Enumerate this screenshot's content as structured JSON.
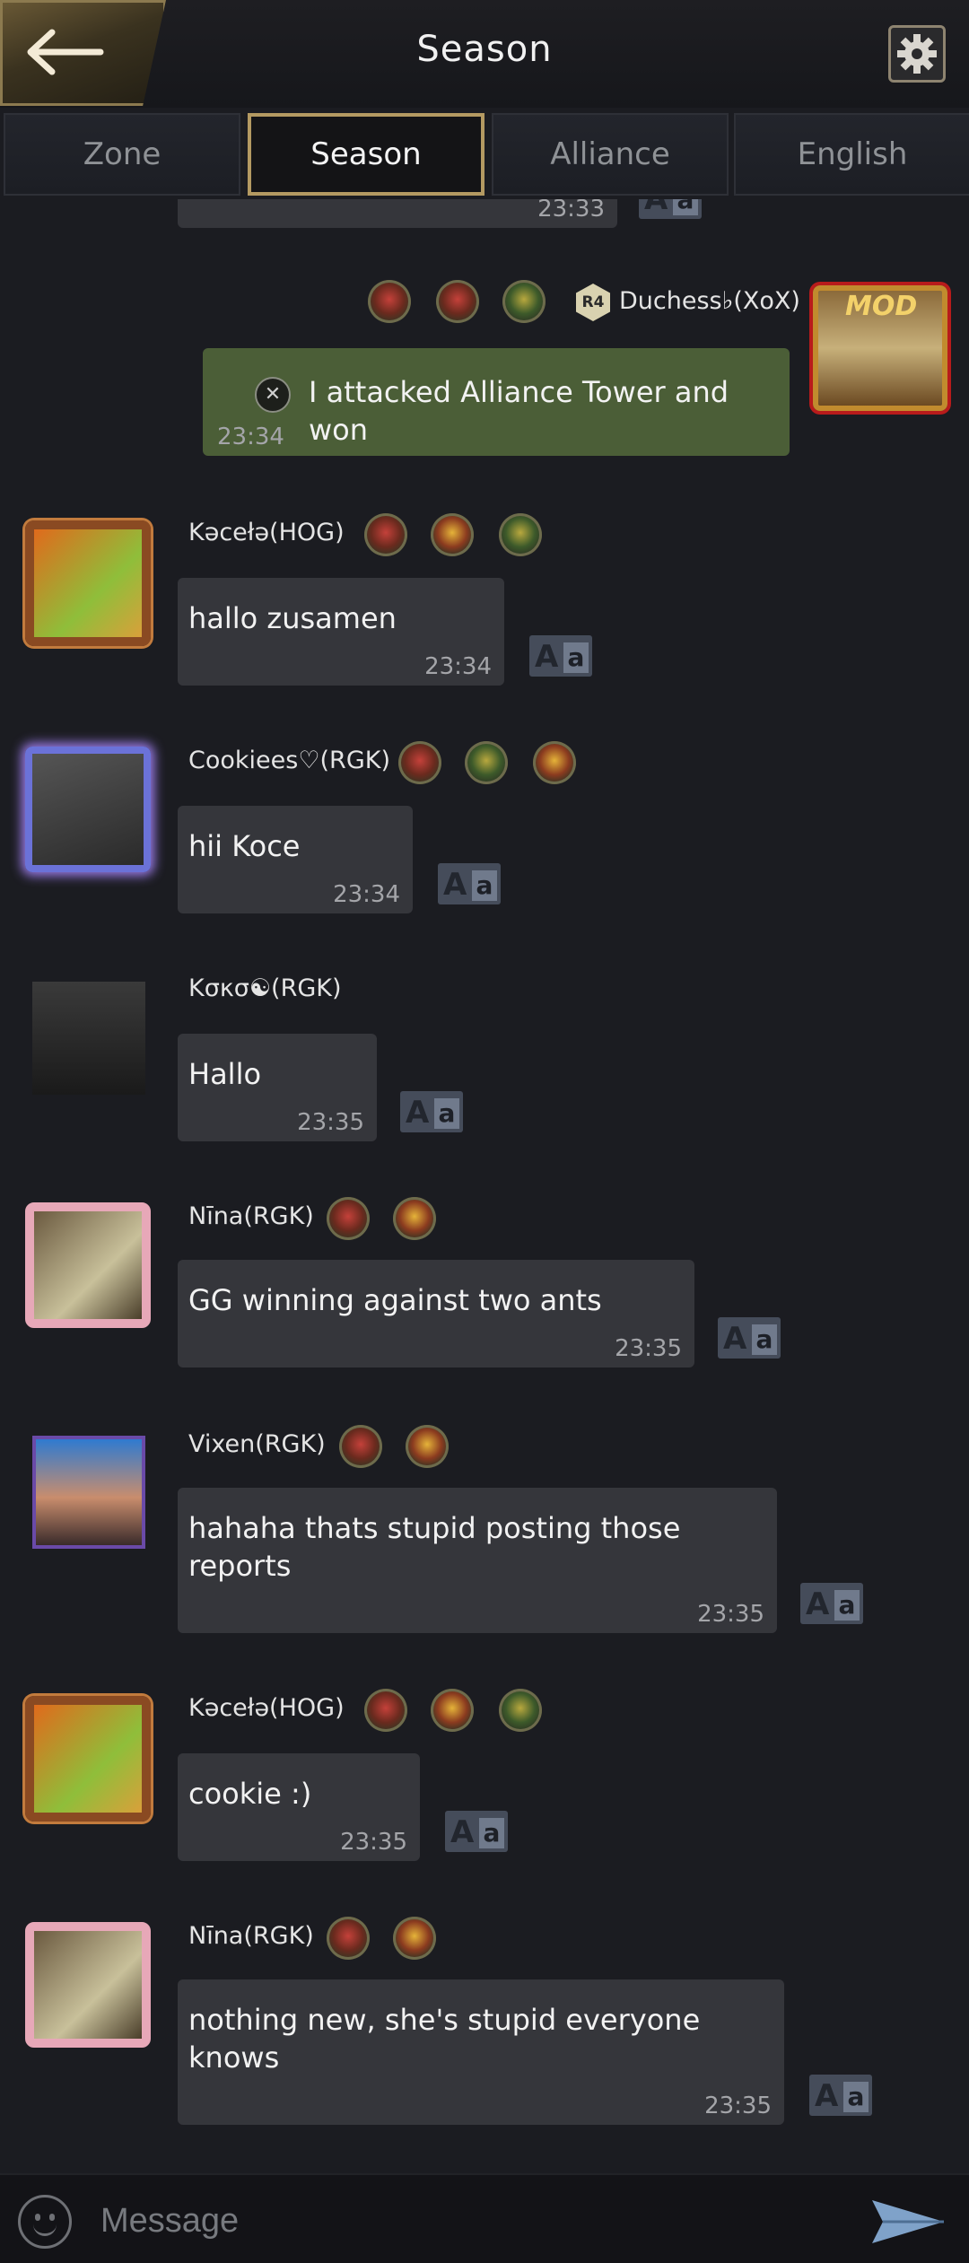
{
  "header": {
    "title": "Season",
    "back_icon": "arrow-left-icon",
    "settings_icon": "gear-icon"
  },
  "tabs": [
    {
      "label": "Zone",
      "active": false
    },
    {
      "label": "Season",
      "active": true
    },
    {
      "label": "Alliance",
      "active": false
    },
    {
      "label": "English",
      "active": false
    }
  ],
  "top_partial_time": "23:33",
  "messages": [
    {
      "user": "Duchess♭(XoX)",
      "rank": "R4",
      "avatar_label": "MOD",
      "side": "right",
      "text": "I attacked Alliance Tower and won",
      "time": "23:34",
      "system_icon": "crossed-swords-icon"
    },
    {
      "user": "Kəcełə(HOG)",
      "side": "left",
      "text": "hallo zusamen",
      "time": "23:34"
    },
    {
      "user": "Cookiees♡(RGK)",
      "side": "left",
      "text": "hii Koce",
      "time": "23:34"
    },
    {
      "user": "Kσκσ☯(RGK)",
      "side": "left",
      "text": "Hallo",
      "time": "23:35"
    },
    {
      "user": "Nīna(RGK)",
      "side": "left",
      "text": "GG winning against two ants",
      "time": "23:35"
    },
    {
      "user": "Vixen(RGK)",
      "side": "left",
      "text": "hahaha thats stupid posting those\nreports",
      "time": "23:35"
    },
    {
      "user": "Kəcełə(HOG)",
      "side": "left",
      "text": "cookie :)",
      "time": "23:35"
    },
    {
      "user": "Nīna(RGK)",
      "side": "left",
      "text": "nothing new, she's stupid everyone\nknows",
      "time": "23:35"
    }
  ],
  "translate_label": {
    "a1": "A",
    "a2": "a"
  },
  "input": {
    "placeholder": "Message"
  },
  "colors": {
    "accent_gold": "#b49a62",
    "system_bubble": "#4b5e37",
    "bubble": "#35363b"
  }
}
